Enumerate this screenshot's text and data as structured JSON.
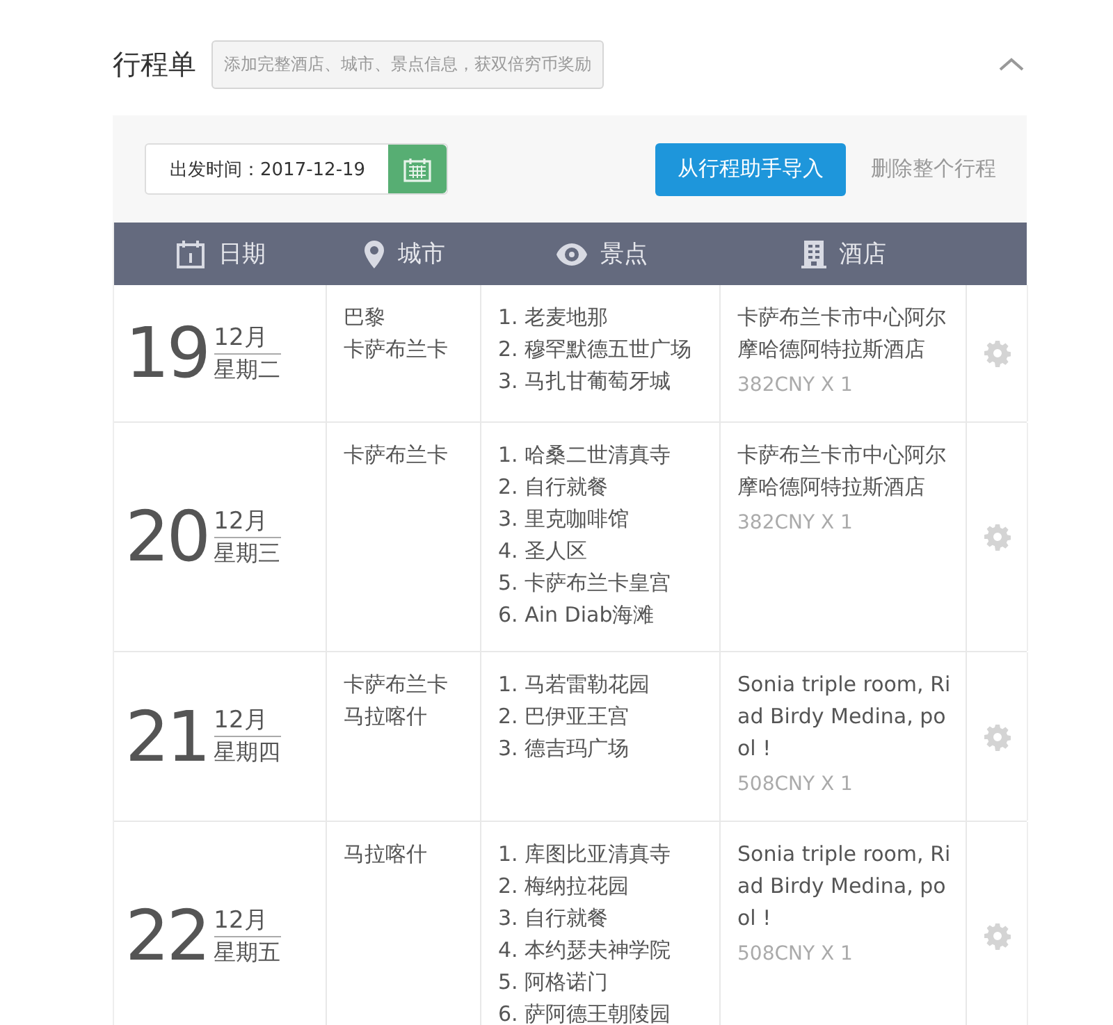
{
  "title": "行程单",
  "tip": "添加完整酒店、城市、景点信息，获双倍穷币奖励",
  "toolbar": {
    "date_field": {
      "value": "出发时间：2017-12-19"
    },
    "import_button": "从行程助手导入",
    "delete_link": "删除整个行程"
  },
  "columns": [
    {
      "label": "日期"
    },
    {
      "label": "城市"
    },
    {
      "label": "景点"
    },
    {
      "label": "酒店"
    }
  ],
  "days": [
    {
      "day": "19",
      "month": "12月",
      "weekday": "星期二",
      "cities": [
        "巴黎",
        "卡萨布兰卡"
      ],
      "sights": [
        "1. 老麦地那",
        "2. 穆罕默德五世广场",
        "3. 马扎甘葡萄牙城"
      ],
      "hotel": "卡萨布兰卡市中心阿尔摩哈德阿特拉斯酒店",
      "price": "382CNY X 1"
    },
    {
      "day": "20",
      "month": "12月",
      "weekday": "星期三",
      "cities": [
        "卡萨布兰卡"
      ],
      "sights": [
        "1. 哈桑二世清真寺",
        "2. 自行就餐",
        "3. 里克咖啡馆",
        "4. 圣人区",
        "5. 卡萨布兰卡皇宫",
        "6. Ain Diab海滩"
      ],
      "hotel": "卡萨布兰卡市中心阿尔摩哈德阿特拉斯酒店",
      "price": "382CNY X 1"
    },
    {
      "day": "21",
      "month": "12月",
      "weekday": "星期四",
      "cities": [
        "卡萨布兰卡",
        "马拉喀什"
      ],
      "sights": [
        "1. 马若雷勒花园",
        "2. 巴伊亚王宫",
        "3. 德吉玛广场"
      ],
      "hotel": "Sonia triple room, Riad Birdy Medina, pool !",
      "price": "508CNY X 1"
    },
    {
      "day": "22",
      "month": "12月",
      "weekday": "星期五",
      "cities": [
        "马拉喀什"
      ],
      "sights": [
        "1. 库图比亚清真寺",
        "2. 梅纳拉花园",
        "3. 自行就餐",
        "4. 本约瑟夫神学院",
        "5. 阿格诺门",
        "6. 萨阿德王朝陵园"
      ],
      "hotel": "Sonia triple room, Riad Birdy Medina, pool !",
      "price": "508CNY X 1"
    }
  ]
}
